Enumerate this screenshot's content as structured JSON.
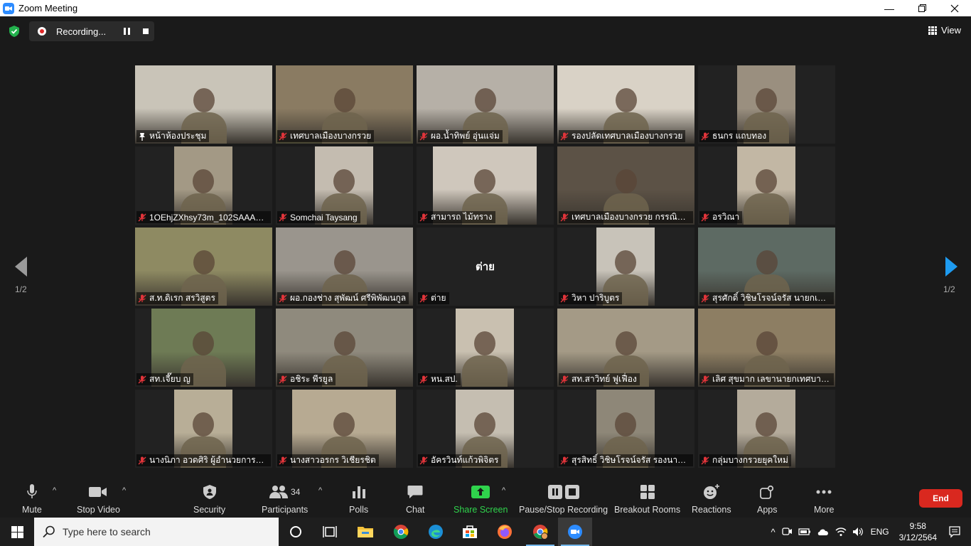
{
  "window": {
    "title": "Zoom Meeting"
  },
  "topbar": {
    "recording_label": "Recording...",
    "view_label": "View"
  },
  "pagination": {
    "left": "1/2",
    "right": "1/2"
  },
  "tiles": [
    {
      "name": "หน้าห้องประชุม",
      "pin": true,
      "bg": "#c9c4b8",
      "cam": [
        0,
        193
      ]
    },
    {
      "name": "เทศบาลเมืองบางกรวย",
      "active": true,
      "bg": "#8a7b62",
      "cam": [
        0,
        193
      ]
    },
    {
      "name": "ผอ.น้ำทิพย์ อุ่นแจ่ม",
      "bg": "#b6b0a7",
      "cam": [
        0,
        193
      ]
    },
    {
      "name": "รองปลัดเทศบาลเมืองบางกรวย",
      "bg": "#d9d2c6",
      "cam": [
        0,
        193
      ]
    },
    {
      "name": "ธนกร แถบทอง",
      "bg": "#9a8f7f",
      "cam": [
        55,
        82
      ]
    },
    {
      "name": "1OEhjZXhsy73m_102SAAAA...",
      "bg": "#a39985",
      "cam": [
        55,
        82
      ]
    },
    {
      "name": "Somchai Taysang",
      "bg": "#c4bcb0",
      "cam": [
        55,
        82
      ]
    },
    {
      "name": "สามารถ ไม้ทราง",
      "bg": "#cfc7bc",
      "cam": [
        23,
        146
      ]
    },
    {
      "name": "เทศบาลเมืองบางกรวย กรรณิการ...",
      "bg": "#5c5246",
      "cam": [
        0,
        193
      ]
    },
    {
      "name": "อรวิณา",
      "bg": "#c2b7a4",
      "cam": [
        55,
        82
      ]
    },
    {
      "name": "ส.ท.ดิเรก สรวิสูตร",
      "bg": "#8e8a62",
      "cam": [
        0,
        193
      ]
    },
    {
      "name": "ผอ.กองช่าง สุพัฒน์ ศรีพิพัฒนกูล",
      "bg": "#9a958d",
      "cam": [
        0,
        193
      ]
    },
    {
      "name": "ต่าย",
      "center": "ต่าย",
      "bg": "#222222",
      "cam": [
        0,
        0
      ]
    },
    {
      "name": "วิหา ปาริบูตร",
      "bg": "#c8c3b9",
      "cam": [
        55,
        82
      ]
    },
    {
      "name": "สุรศักดิ์ วิชิษโรจน์จรัส นายกเทศ...",
      "bg": "#5d6a63",
      "cam": [
        0,
        193
      ]
    },
    {
      "name": "สท.เจี๊ยบ ญ",
      "bg": "#6e7b55",
      "cam": [
        23,
        146
      ]
    },
    {
      "name": "อชิระ พีรยูล",
      "bg": "#8f8a7d",
      "cam": [
        0,
        193
      ]
    },
    {
      "name": "หน.สป.",
      "bg": "#c9c0b0",
      "cam": [
        55,
        82
      ]
    },
    {
      "name": "สท.สาวิทย์ ฟูเฟื่อง",
      "bg": "#a49a86",
      "cam": [
        0,
        193
      ]
    },
    {
      "name": "เลิศ สุขมาก เลขานายกเทศบาลเ...",
      "bg": "#8d7e63",
      "cam": [
        0,
        193
      ]
    },
    {
      "name": "นางนิภา อวดศิริ ผู้อำนวยการกอ...",
      "bg": "#b8ae97",
      "cam": [
        55,
        82
      ]
    },
    {
      "name": "นางสาวอรกร วิเชียรชิต",
      "bg": "#b7aa92",
      "cam": [
        23,
        146
      ]
    },
    {
      "name": "อัครวินท์แก้วพิจิตร",
      "bg": "#c5beb1",
      "cam": [
        55,
        82
      ]
    },
    {
      "name": "สุรสิทธิ์ วิชิษโรจน์จรัส รองนายกเ...",
      "bg": "#8e8778",
      "cam": [
        55,
        82
      ]
    },
    {
      "name": "กลุ่มบางกรวยยุคใหม่",
      "bg": "#b4ab9b",
      "cam": [
        55,
        82
      ]
    }
  ],
  "toolbar": {
    "mute": "Mute",
    "stop_video": "Stop Video",
    "security": "Security",
    "participants": "Participants",
    "participants_count": "34",
    "polls": "Polls",
    "chat": "Chat",
    "share_screen": "Share Screen",
    "pause_stop_recording": "Pause/Stop Recording",
    "breakout_rooms": "Breakout Rooms",
    "reactions": "Reactions",
    "apps": "Apps",
    "more": "More",
    "end": "End"
  },
  "taskbar": {
    "search_placeholder": "Type here to search",
    "language": "ENG",
    "time": "9:58",
    "date": "3/12/2564"
  }
}
